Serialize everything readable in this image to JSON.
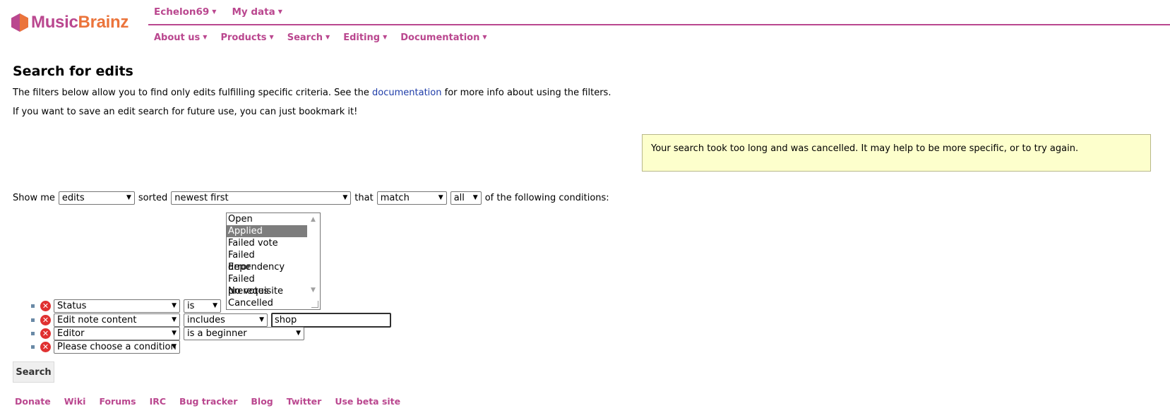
{
  "brand": {
    "name_part1": "Music",
    "name_part2": "Brainz",
    "color_primary": "#ba478f",
    "color_secondary": "#eb743b"
  },
  "topnav": [
    {
      "label": "Echelon69"
    },
    {
      "label": "My data"
    }
  ],
  "mainnav": [
    {
      "label": "About us"
    },
    {
      "label": "Products"
    },
    {
      "label": "Search"
    },
    {
      "label": "Editing"
    },
    {
      "label": "Documentation"
    }
  ],
  "page": {
    "title": "Search for edits",
    "intro_before": "The filters below allow you to find only edits fulfilling specific criteria. See the ",
    "intro_link": "documentation",
    "intro_after": " for more info about using the filters.",
    "bookmark_note": "If you want to save an edit search for future use, you can just bookmark it!"
  },
  "warning": "Your search took too long and was cancelled. It may help to be more specific, or to try again.",
  "show_row": {
    "show_me": "Show me",
    "type_value": "edits",
    "sorted": "sorted",
    "sort_value": "newest first",
    "that": "that",
    "match_value": "match",
    "quantifier_value": "all",
    "suffix": "of the following conditions:"
  },
  "status_options": [
    "Open",
    "Applied",
    "Failed vote",
    "Failed dependency",
    "Error",
    "Failed prerequisite",
    "No votes",
    "Cancelled"
  ],
  "status_selected": "Applied",
  "conditions": [
    {
      "field": "Status",
      "operator": "is"
    },
    {
      "field": "Edit note content",
      "operator": "includes",
      "value": "shop"
    },
    {
      "field": "Editor",
      "operator": "is a beginner"
    },
    {
      "field": "Please choose a condition"
    }
  ],
  "search_button": "Search",
  "footer": [
    "Donate",
    "Wiki",
    "Forums",
    "IRC",
    "Bug tracker",
    "Blog",
    "Twitter",
    "Use beta site"
  ]
}
